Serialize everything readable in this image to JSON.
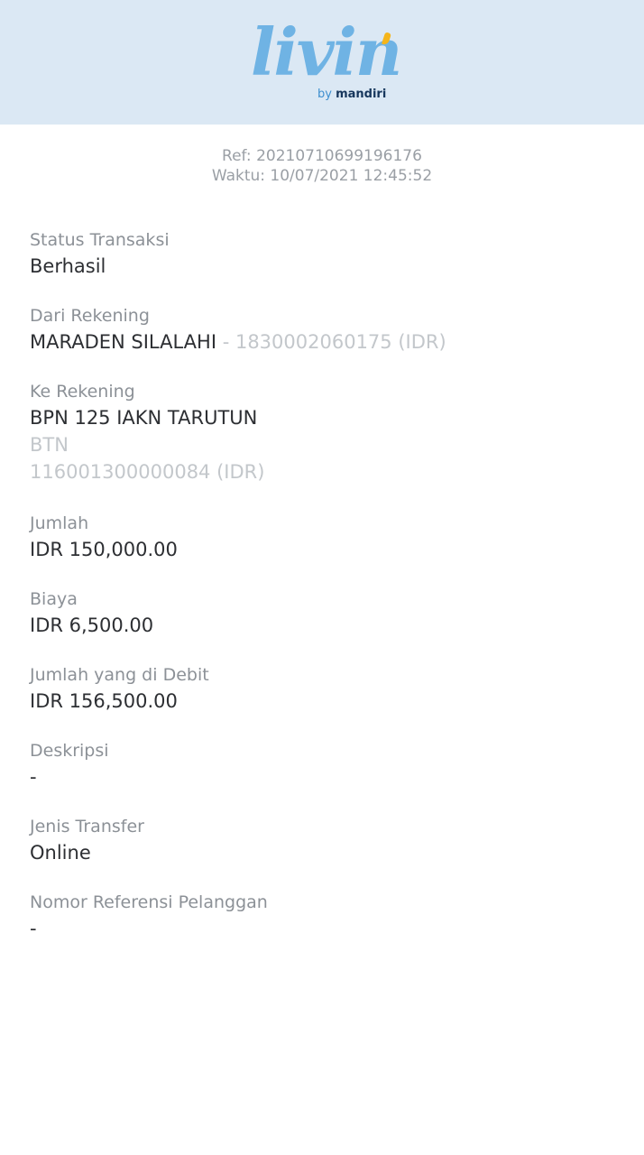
{
  "header": {
    "logo_word": "livin",
    "logo_by": "by",
    "logo_brand": "mandiri",
    "accent_color": "#6fb3e4",
    "apostrophe_color": "#f5b51b",
    "background_color": "#dbe8f4"
  },
  "receipt": {
    "ref": "Ref: 20210710699196176",
    "time": "Waktu: 10/07/2021 12:45:52"
  },
  "fields": {
    "status": {
      "label": "Status Transaksi",
      "value": "Berhasil"
    },
    "from": {
      "label": "Dari Rekening",
      "name": "MARADEN SILALAHI",
      "account": " - 1830002060175 (IDR)"
    },
    "to": {
      "label": "Ke Rekening",
      "name": "BPN 125 IAKN TARUTUN",
      "bank": "BTN",
      "account": "116001300000084 (IDR)"
    },
    "amount": {
      "label": "Jumlah",
      "value": "IDR 150,000.00"
    },
    "fee": {
      "label": "Biaya",
      "value": "IDR 6,500.00"
    },
    "debit": {
      "label": "Jumlah yang di Debit",
      "value": "IDR 156,500.00"
    },
    "description": {
      "label": "Deskripsi",
      "value": "-"
    },
    "transfer_type": {
      "label": "Jenis Transfer",
      "value": "Online"
    },
    "customer_ref": {
      "label": "Nomor Referensi Pelanggan",
      "value": "-"
    }
  }
}
